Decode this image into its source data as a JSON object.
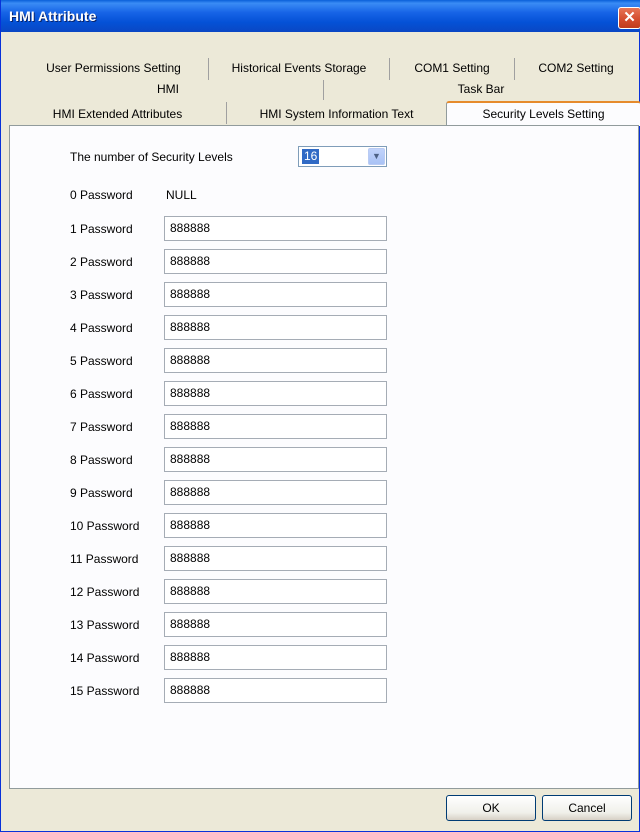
{
  "window": {
    "title": "HMI Attribute"
  },
  "tabs": {
    "row1": [
      "User Permissions Setting",
      "Historical Events Storage",
      "COM1 Setting",
      "COM2 Setting"
    ],
    "row2": [
      "HMI",
      "Task Bar"
    ],
    "row3": [
      "HMI Extended Attributes",
      "HMI System Information Text",
      "Security Levels Setting"
    ],
    "active": "Security Levels Setting"
  },
  "security": {
    "levels_label": "The number of Security Levels",
    "levels_value": "16",
    "password0_label": "0 Password",
    "password0_value": "NULL",
    "passwords": [
      {
        "label": "1 Password",
        "value": "888888"
      },
      {
        "label": "2 Password",
        "value": "888888"
      },
      {
        "label": "3 Password",
        "value": "888888"
      },
      {
        "label": "4 Password",
        "value": "888888"
      },
      {
        "label": "5 Password",
        "value": "888888"
      },
      {
        "label": "6 Password",
        "value": "888888"
      },
      {
        "label": "7 Password",
        "value": "888888"
      },
      {
        "label": "8 Password",
        "value": "888888"
      },
      {
        "label": "9 Password",
        "value": "888888"
      },
      {
        "label": "10 Password",
        "value": "888888"
      },
      {
        "label": "11 Password",
        "value": "888888"
      },
      {
        "label": "12 Password",
        "value": "888888"
      },
      {
        "label": "13 Password",
        "value": "888888"
      },
      {
        "label": "14 Password",
        "value": "888888"
      },
      {
        "label": "15 Password",
        "value": "888888"
      }
    ]
  },
  "buttons": {
    "ok": "OK",
    "cancel": "Cancel"
  },
  "icons": {
    "close": "close-icon",
    "dropdown": "chevron-down-icon"
  },
  "colors": {
    "titlebar": "#0a5fd8",
    "active_tab_accent": "#e68b2c",
    "selection": "#316ac5"
  }
}
